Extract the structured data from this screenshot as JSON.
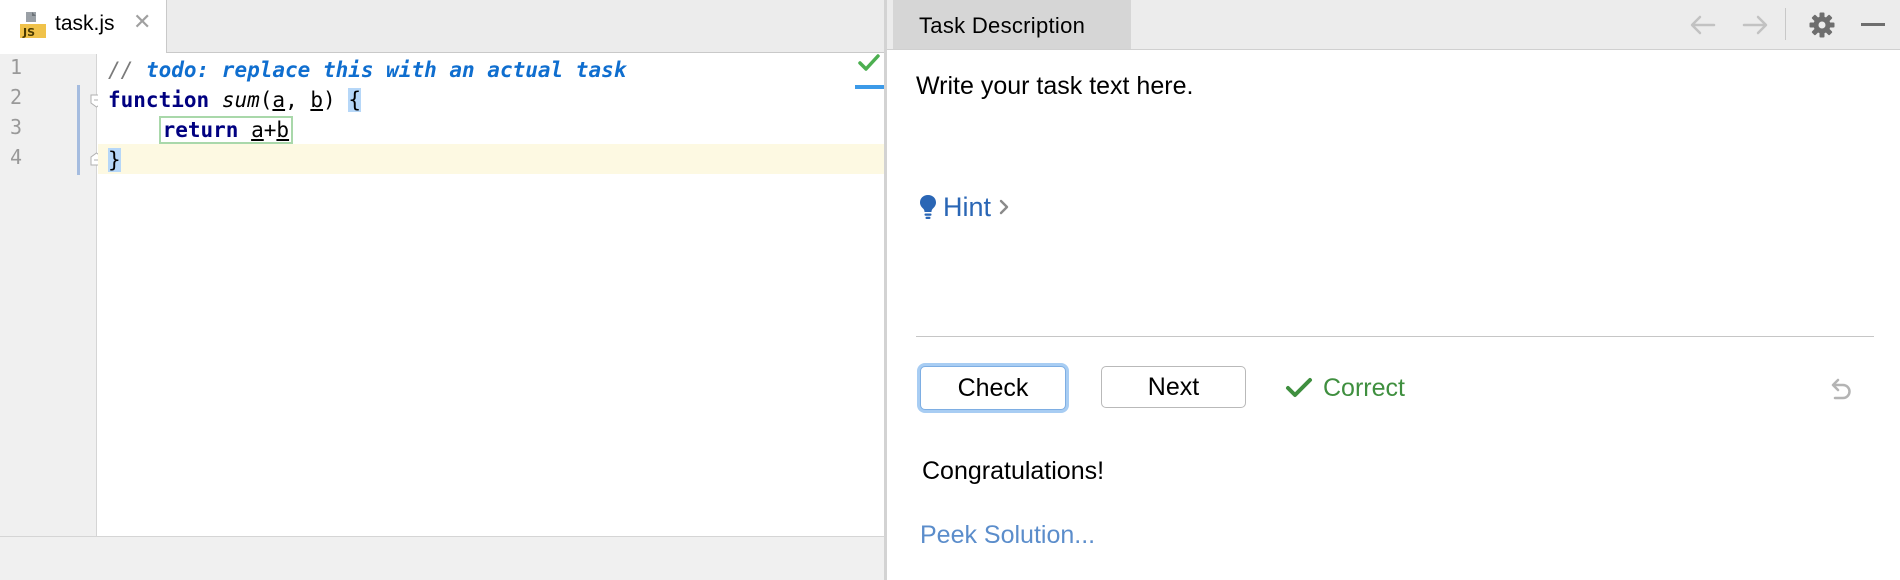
{
  "editor": {
    "tab": {
      "filename": "task.js",
      "icon": "javascript-file-icon",
      "close_icon": "close-icon"
    },
    "line_numbers": [
      "1",
      "2",
      "3",
      "4"
    ],
    "current_line": 4,
    "code": {
      "line1": {
        "comment_prefix": "// ",
        "todo_text": "todo: replace this with an actual task"
      },
      "line2": {
        "keyword": "function",
        "fn_name": "sum",
        "open_paren": "(",
        "param_a": "a",
        "comma": ", ",
        "param_b": "b",
        "close_paren": ") ",
        "brace": "{"
      },
      "line3": {
        "indent": "    ",
        "keyword": "return",
        "space": " ",
        "expr_a": "a",
        "op": "+",
        "expr_b": "b"
      },
      "line4": {
        "brace": "}"
      }
    },
    "inspection_status": "check-icon",
    "colors": {
      "keyword": "#000080",
      "todo": "#0f6ecf",
      "current_line_bg": "#fdf9e2",
      "brace_highlight": "#b6d7f8"
    }
  },
  "task_panel": {
    "title": "Task Description",
    "header_icons": [
      "arrow-left-icon",
      "arrow-right-icon",
      "gear-icon",
      "minimize-icon"
    ],
    "task_text": "Write your task text here.",
    "hint": {
      "label": "Hint",
      "icon": "lightbulb-icon"
    },
    "buttons": {
      "check": "Check",
      "next": "Next"
    },
    "result": {
      "label": "Correct",
      "icon": "check-icon",
      "color": "#3f8f3f"
    },
    "reset_icon": "undo-icon",
    "feedback": "Congratulations!",
    "peek_solution": "Peek Solution..."
  }
}
